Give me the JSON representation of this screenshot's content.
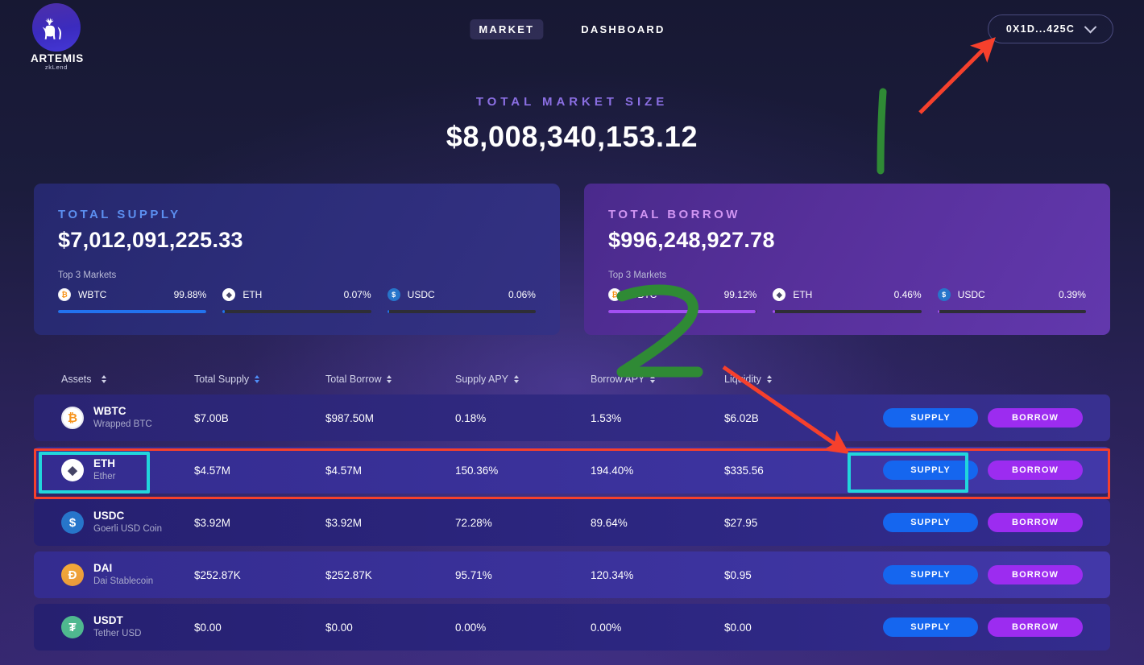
{
  "header": {
    "logo": {
      "name": "ARTEMIS",
      "sub": "zkLend",
      "icon": "deer-logo-icon"
    },
    "nav": [
      {
        "label": "MARKET",
        "active": true
      },
      {
        "label": "DASHBOARD",
        "active": false
      }
    ],
    "wallet": {
      "address": "0X1D...425C",
      "icon": "chevron-down-icon"
    }
  },
  "hero": {
    "label": "TOTAL MARKET SIZE",
    "value": "$8,008,340,153.12"
  },
  "cards": [
    {
      "label": "TOTAL SUPPLY",
      "value": "$7,012,091,225.33",
      "top3_label": "Top 3 Markets",
      "accent": "#5c8ff0",
      "bar_color": "#2272ef",
      "markets": [
        {
          "symbol": "WBTC",
          "pct": "99.88%",
          "fill": 99.88,
          "icon": "wbtc-coin-icon"
        },
        {
          "symbol": "ETH",
          "pct": "0.07%",
          "fill": 1.5,
          "icon": "eth-coin-icon"
        },
        {
          "symbol": "USDC",
          "pct": "0.06%",
          "fill": 1.5,
          "icon": "usdc-coin-icon"
        }
      ]
    },
    {
      "label": "TOTAL BORROW",
      "value": "$996,248,927.78",
      "top3_label": "Top 3 Markets",
      "accent": "#d095f2",
      "bar_color": "#a24ff2",
      "markets": [
        {
          "symbol": "WBTC",
          "pct": "99.12%",
          "fill": 99.12,
          "icon": "wbtc-coin-icon"
        },
        {
          "symbol": "ETH",
          "pct": "0.46%",
          "fill": 1.5,
          "icon": "eth-coin-icon"
        },
        {
          "symbol": "USDC",
          "pct": "0.39%",
          "fill": 1.5,
          "icon": "usdc-coin-icon"
        }
      ]
    }
  ],
  "table": {
    "columns": [
      {
        "label": "Assets",
        "sorted": false
      },
      {
        "label": "Total Supply",
        "sorted": true
      },
      {
        "label": "Total Borrow",
        "sorted": false
      },
      {
        "label": "Supply APY",
        "sorted": false
      },
      {
        "label": "Borrow APY",
        "sorted": false
      },
      {
        "label": "Liquidity",
        "sorted": false
      }
    ],
    "actions": {
      "supply": "SUPPLY",
      "borrow": "BORROW"
    },
    "rows": [
      {
        "symbol": "WBTC",
        "name": "Wrapped BTC",
        "icon": "wbtc-asset-icon",
        "total_supply": "$7.00B",
        "total_borrow": "$987.50M",
        "supply_apy": "0.18%",
        "borrow_apy": "1.53%",
        "liquidity": "$6.02B"
      },
      {
        "symbol": "ETH",
        "name": "Ether",
        "icon": "eth-asset-icon",
        "total_supply": "$4.57M",
        "total_borrow": "$4.57M",
        "supply_apy": "150.36%",
        "borrow_apy": "194.40%",
        "liquidity": "$335.56"
      },
      {
        "symbol": "USDC",
        "name": "Goerli USD Coin",
        "icon": "usdc-asset-icon",
        "total_supply": "$3.92M",
        "total_borrow": "$3.92M",
        "supply_apy": "72.28%",
        "borrow_apy": "89.64%",
        "liquidity": "$27.95"
      },
      {
        "symbol": "DAI",
        "name": "Dai Stablecoin",
        "icon": "dai-asset-icon",
        "total_supply": "$252.87K",
        "total_borrow": "$252.87K",
        "supply_apy": "95.71%",
        "borrow_apy": "120.34%",
        "liquidity": "$0.95"
      },
      {
        "symbol": "USDT",
        "name": "Tether USD",
        "icon": "usdt-asset-icon",
        "total_supply": "$0.00",
        "total_borrow": "$0.00",
        "supply_apy": "0.00%",
        "borrow_apy": "0.00%",
        "liquidity": "$0.00"
      }
    ]
  },
  "annotations": {
    "red": "#f6402c",
    "green": "#2f8a35",
    "cyan": "#21d6dc",
    "step_marks": [
      "1",
      "2"
    ]
  }
}
